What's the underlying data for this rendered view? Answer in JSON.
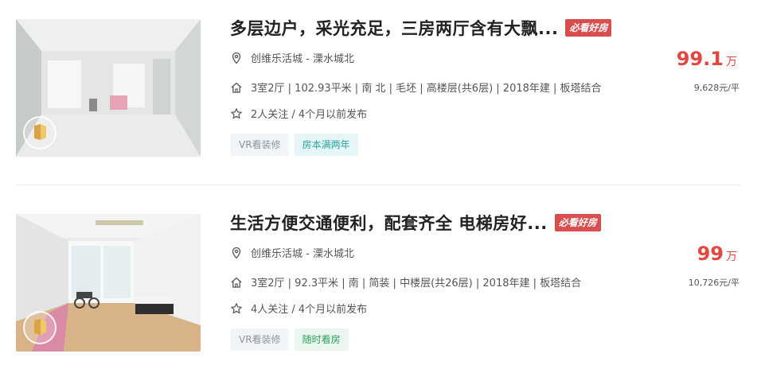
{
  "colors": {
    "accent": "#e2483f",
    "hot_tag": "#d94d4d"
  },
  "listings": [
    {
      "title": "多层边户，采光充足，三房两厅含有大飘...",
      "hot_tag": "必看好房",
      "location": "创维乐活城 - 溧水城北",
      "house_info": "3室2厅 | 102.93平米 | 南 北 | 毛坯 | 高楼层(共6层) | 2018年建 | 板塔结合",
      "follow_info": "2人关注 / 4个月以前发布",
      "tags": [
        "VR看装修",
        "房本满两年"
      ],
      "price": "99.1",
      "price_unit": "万",
      "unit_price": "9,628元/平"
    },
    {
      "title": "生活方便交通便利，配套齐全 电梯房好...",
      "hot_tag": "必看好房",
      "location": "创维乐活城 - 溧水城北",
      "house_info": "3室2厅 | 92.3平米 | 南 | 简装 | 中楼层(共26层) | 2018年建 | 板塔结合",
      "follow_info": "4人关注 / 4个月以前发布",
      "tags": [
        "VR看装修",
        "随时看房"
      ],
      "price": "99",
      "price_unit": "万",
      "unit_price": "10,726元/平"
    }
  ]
}
